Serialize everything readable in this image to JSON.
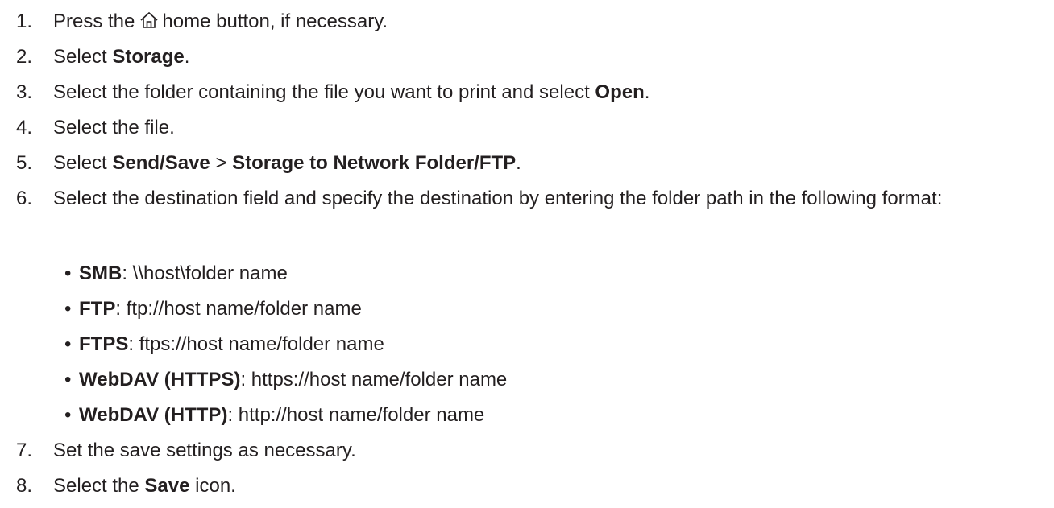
{
  "steps": [
    {
      "num": "1.",
      "a": "Press the",
      "b": "home button, if necessary."
    },
    {
      "num": "2.",
      "a": "Select ",
      "b": "Storage",
      "c": "."
    },
    {
      "num": "3.",
      "a": "Select the folder containing the file you want to print and select ",
      "b": "Open",
      "c": "."
    },
    {
      "num": "4.",
      "a": "Select the file."
    },
    {
      "num": "5.",
      "a": "Select ",
      "b": "Send/Save",
      "c": " > ",
      "d": "Storage to Network Folder/FTP",
      "e": "."
    },
    {
      "num": "6.",
      "a": "Select the destination field and specify the destination by entering the folder path in the following format:"
    },
    {
      "num": "7.",
      "a": "Set the save settings as necessary."
    },
    {
      "num": "8.",
      "a": "Select the ",
      "b": "Save",
      "c": " icon."
    }
  ],
  "formats": [
    {
      "label": "SMB",
      "value": ": \\\\host\\folder name"
    },
    {
      "label": "FTP",
      "value": ": ftp://host name/folder name"
    },
    {
      "label": "FTPS",
      "value": ": ftps://host name/folder name"
    },
    {
      "label": "WebDAV (HTTPS)",
      "value": ": https://host name/folder name"
    },
    {
      "label": "WebDAV (HTTP)",
      "value": ": http://host name/folder name"
    }
  ],
  "bullet": "•",
  "icons": {
    "home": "home-icon"
  }
}
